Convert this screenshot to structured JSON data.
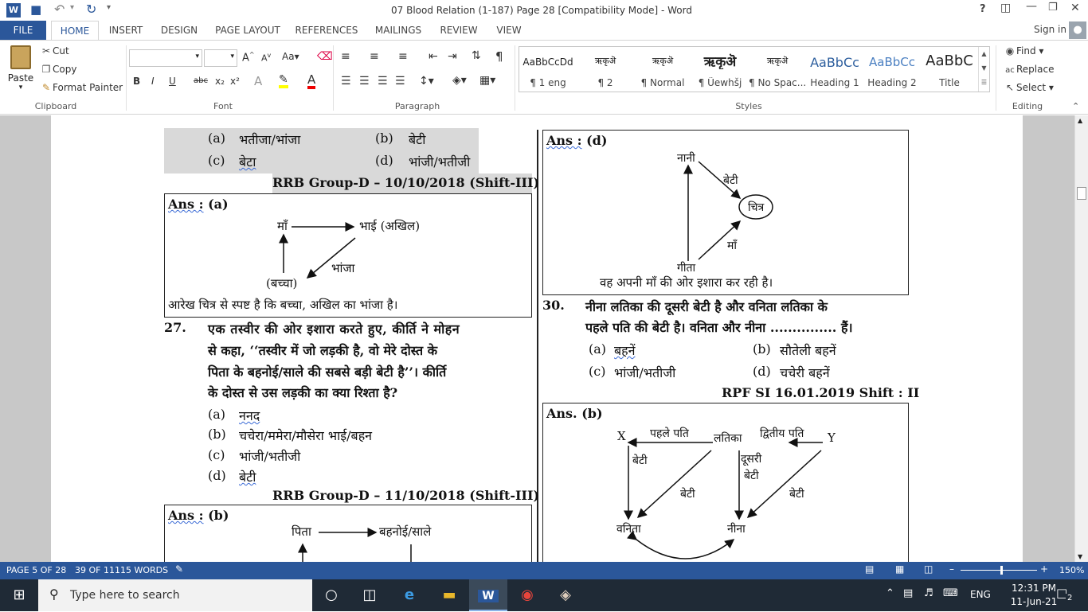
{
  "window": {
    "title": "07  Blood Relation  (1-187) Page 28 [Compatibility Mode] - Word",
    "help": "?",
    "signin": "Sign in"
  },
  "tabs": [
    "FILE",
    "HOME",
    "INSERT",
    "DESIGN",
    "PAGE LAYOUT",
    "REFERENCES",
    "MAILINGS",
    "REVIEW",
    "VIEW"
  ],
  "ribbon": {
    "clipboard": {
      "paste": "Paste",
      "cut": "Cut",
      "copy": "Copy",
      "format_painter": "Format Painter",
      "label": "Clipboard"
    },
    "font": {
      "label": "Font",
      "bold": "B",
      "italic": "I",
      "underline": "U",
      "strike": "abc",
      "sub": "x₂",
      "sup": "x²"
    },
    "paragraph": {
      "label": "Paragraph"
    },
    "styles": {
      "label": "Styles",
      "items": [
        {
          "preview": "AaBbCcDd",
          "name": "¶ 1 eng"
        },
        {
          "preview": "ऋकृऄ",
          "name": "¶ 2"
        },
        {
          "preview": "ऋकृऄ",
          "name": "¶ Normal"
        },
        {
          "preview": "ऋकृऄ",
          "name": "¶ Üewhšj"
        },
        {
          "preview": "ऋकृऄ",
          "name": "¶ No Spac..."
        },
        {
          "preview": "AaBbCc",
          "name": "Heading 1"
        },
        {
          "preview": "AaBbCc",
          "name": "Heading 2"
        },
        {
          "preview": "AaBbC",
          "name": "Title"
        }
      ]
    },
    "editing": {
      "label": "Editing",
      "find": "Find",
      "replace": "Replace",
      "select": "Select"
    }
  },
  "doc": {
    "left": {
      "q26_opts": {
        "a_l": "(a)",
        "a": "भतीजा/भांजा",
        "b_l": "(b)",
        "b": "बेटी",
        "c_l": "(c)",
        "c": "बेटा",
        "d_l": "(d)",
        "d": "भांजी/भतीजी"
      },
      "src1": "RRB Group-D – 10/10/2018 (Shift-III)",
      "ans1": {
        "label": "Ans :",
        "value": "(a)",
        "n1": "माँ",
        "n2": "भाई (अखिल)",
        "n3": "(बच्चा)",
        "n4": "भांजा",
        "explain": "आरेख चित्र से स्पष्ट है कि बच्चा, अखिल का भांजा है।"
      },
      "q27": {
        "num": "27.",
        "l1": "एक तस्वीर की ओर इशारा करते हुए, कीर्ति ने मोहन",
        "l2": "से कहा, ‘‘तस्वीर में जो लड़की है, वो मेरे दोस्त के",
        "l3": "पिता के बहनोई/साले की सबसे बड़ी बेटी है’’। कीर्ति",
        "l4": "के दोस्त से उस लड़की का क्या रिश्ता है?"
      },
      "q27_opts": {
        "a_l": "(a)",
        "a": "ननद",
        "b_l": "(b)",
        "b": "चचेरा/ममेरा/मौसेरा भाई/बहन",
        "c_l": "(c)",
        "c": "भांजी/भतीजी",
        "d_l": "(d)",
        "d": "बेटी"
      },
      "src2": "RRB Group-D – 11/10/2018 (Shift-III)",
      "ans2": {
        "label": "Ans :",
        "value": "(b)",
        "n1": "पिता",
        "n2": "बहनोई/साले"
      }
    },
    "right": {
      "ans": {
        "label": "Ans :",
        "value": "(d)",
        "nani": "नानी",
        "beti": "बेटी",
        "chitra": "चित्र",
        "maa": "माँ",
        "gita": "गीता",
        "explain": "वह अपनी माँ की ओर इशारा कर रही है।"
      },
      "q30": {
        "num": "30.",
        "l1": "नीना लतिका की दूसरी बेटी है और वनिता लतिका के",
        "l2": "पहले पति की बेटी है। वनिता और नीना ............... हैं।"
      },
      "q30_opts": {
        "a_l": "(a)",
        "a": "बहनें",
        "b_l": "(b)",
        "b": "सौतेली बहनें",
        "c_l": "(c)",
        "c": "भांजी/भतीजी",
        "d_l": "(d)",
        "d": "चचेरी बहनें"
      },
      "src": "RPF SI 16.01.2019 Shift : II",
      "ans2": {
        "label": "Ans.",
        "value": "(b)",
        "x": "X",
        "y": "Y",
        "pehle": "पहले पति",
        "latika": "लतिका",
        "dvitiya": "द्वितीय पति",
        "beti1": "बेटी",
        "doosri": "दूसरी",
        "beti2": "बेटी",
        "beti3": "बेटी",
        "beti4": "बेटी",
        "vanita": "वनिता",
        "nina": "नीना"
      }
    }
  },
  "status": {
    "page": "PAGE 5 OF 28",
    "words": "39 OF 11115 WORDS",
    "zoom": "150%"
  },
  "taskbar": {
    "search": "Type here to search",
    "lang": "ENG",
    "time": "12:31 PM",
    "date": "11-Jun-21",
    "notif": "2"
  }
}
